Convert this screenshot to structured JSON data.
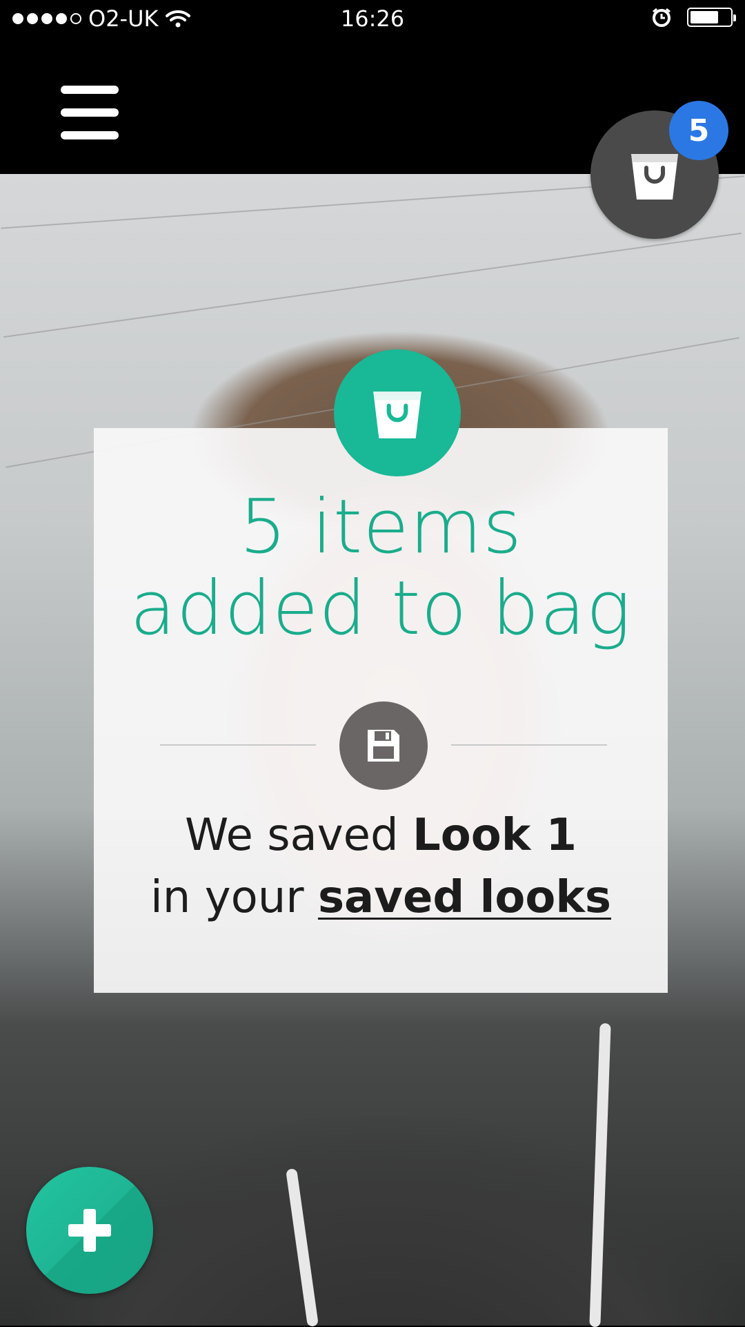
{
  "status_bar": {
    "carrier": "O2-UK",
    "time": "16:26",
    "signal_bars_filled": 4,
    "signal_bars_total": 5,
    "battery_level": 0.6
  },
  "header": {
    "menu_icon": "hamburger-menu-icon",
    "bag_icon": "shopping-bag-icon",
    "bag_count": "5"
  },
  "confirmation": {
    "icon": "shopping-bag-icon",
    "headline_line1": "5 items",
    "headline_line2": "added to bag",
    "save_icon": "floppy-disk-icon",
    "message_prefix": "We saved ",
    "look_name": "Look 1",
    "message_line2_prefix": "in your ",
    "saved_looks_link": "saved looks"
  },
  "fab": {
    "icon": "plus-icon"
  },
  "colors": {
    "accent_green": "#19b896",
    "headline_green": "#1aac8c",
    "badge_blue": "#2b78e4",
    "dark_button": "#4a4a4a"
  }
}
